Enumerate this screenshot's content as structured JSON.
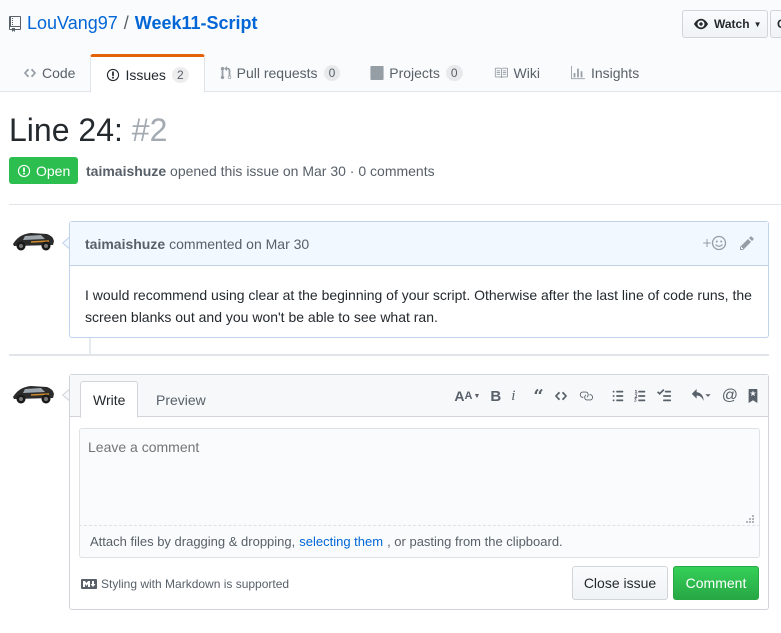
{
  "repo": {
    "owner": "LouVang97",
    "separator": "/",
    "name": "Week11-Script",
    "icon": "repo-icon"
  },
  "header_actions": {
    "watch_label": "Watch",
    "next_label": "C"
  },
  "tabs": [
    {
      "label": "Code",
      "icon": "code-icon",
      "count": ""
    },
    {
      "label": "Issues",
      "icon": "issue-opened-icon",
      "count": "2"
    },
    {
      "label": "Pull requests",
      "icon": "git-pull-request-icon",
      "count": "0"
    },
    {
      "label": "Projects",
      "icon": "project-icon",
      "count": "0"
    },
    {
      "label": "Wiki",
      "icon": "book-icon",
      "count": ""
    },
    {
      "label": "Insights",
      "icon": "graph-icon",
      "count": ""
    }
  ],
  "issue": {
    "title": "Line 24:",
    "number": "#2",
    "state": "Open",
    "author": "taimaishuze",
    "meta_text": "opened this issue on Mar 30 · 0 comments"
  },
  "comment": {
    "author": "taimaishuze",
    "meta": "commented on Mar 30",
    "body": "I would recommend using clear at the beginning of your script. Otherwise after the last line of code runs, the screen blanks out and you won't be able to see what ran."
  },
  "form": {
    "tab_write": "Write",
    "tab_preview": "Preview",
    "placeholder": "Leave a comment",
    "attach_prefix": "Attach files by dragging & dropping,",
    "attach_link": "selecting them",
    "attach_suffix": ", or pasting from the clipboard.",
    "markdown_note": "Styling with Markdown is supported",
    "close_label": "Close issue",
    "comment_label": "Comment",
    "toolbar": [
      "text-size-icon",
      "bold-icon",
      "italic-icon",
      "quote-icon",
      "code-icon",
      "link-icon",
      "list-unordered-icon",
      "list-ordered-icon",
      "tasklist-icon",
      "reply-icon",
      "mention-icon",
      "bookmark-icon"
    ]
  },
  "colors": {
    "accent": "#0366d6",
    "open_green": "#2cbe4e",
    "tab_highlight": "#e36209",
    "comment_border": "#c0d3eb"
  }
}
